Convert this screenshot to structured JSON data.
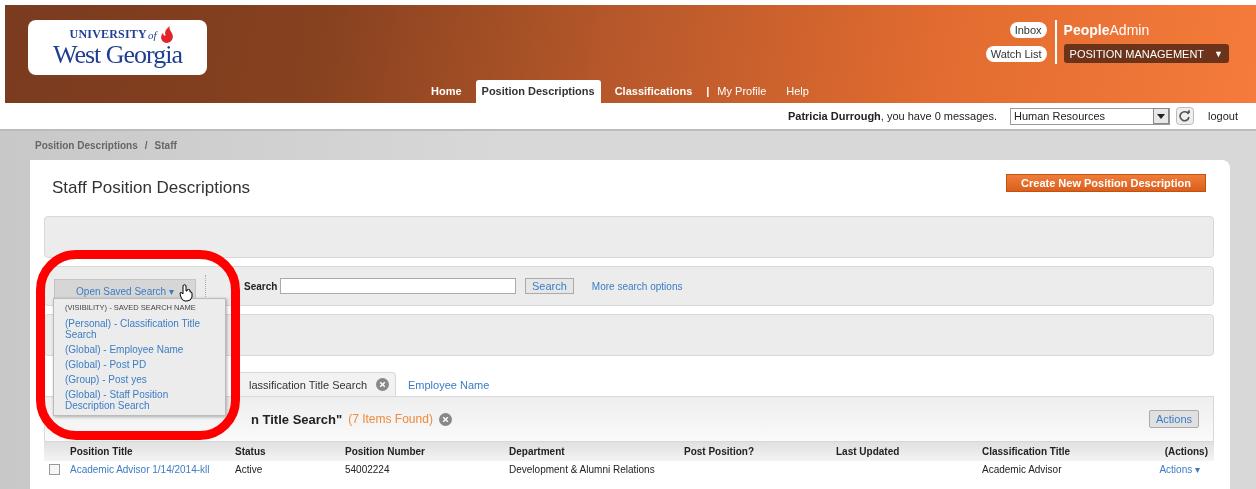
{
  "header": {
    "logo": {
      "line1": "UNIVERSITY",
      "line1_suffix": "of",
      "line2": "West Georgia"
    },
    "nav": [
      {
        "label": "Home",
        "kind": "main",
        "selected": false
      },
      {
        "label": "Position Descriptions",
        "kind": "main",
        "selected": true
      },
      {
        "label": "Classifications",
        "kind": "main",
        "selected": false
      },
      {
        "label": "|",
        "kind": "separator"
      },
      {
        "label": "My Profile",
        "kind": "link",
        "selected": false
      },
      {
        "label": "Help",
        "kind": "link",
        "selected": false
      }
    ],
    "quick_links": [
      "Inbox",
      "Watch List"
    ],
    "product": "**People**Admin",
    "module_menu": {
      "value": "POSITION MANAGEMENT",
      "caret": "▼"
    }
  },
  "user_bar": {
    "greeting": "**Patricia Durrough**, you have 0 messages.",
    "department": "Human Resources",
    "logout": "logout"
  },
  "breadcrumb": {
    "items": [
      "Position Descriptions",
      "Staff"
    ],
    "separator": "/"
  },
  "page": {
    "title": "Staff Position Descriptions",
    "create_button": "Create New Position Description"
  },
  "search": {
    "saved_search_button": "Open Saved Search ▾",
    "label": "Search",
    "button": "Search",
    "more_link": "More search options"
  },
  "saved_search_menu": {
    "header": "(VISIBILITY) - SAVED SEARCH NAME",
    "items": [
      "(Personal) - Classification Title Search",
      "(Global) - Employee Name",
      "(Global) - Post PD",
      "(Group) - Post yes",
      "(Global) - Staff Position Description Search"
    ]
  },
  "result_tabs": [
    {
      "label": "lassification Title Search",
      "selected": true,
      "closable": true
    },
    {
      "label": "Employee Name",
      "selected": false,
      "closable": false
    }
  ],
  "results": {
    "saved_search": "n Title Search\"",
    "count": "(7 Items Found)",
    "actions_button": "Actions"
  },
  "table": {
    "columns": [
      "Position Title",
      "Status",
      "Position Number",
      "Department",
      "Post Position?",
      "Last Updated",
      "Classification Title",
      "(Actions)"
    ],
    "rows": [
      {
        "checked": false,
        "title": "Academic Advisor 1/14/2014-kll",
        "status": "Active",
        "number": "54002224",
        "department": "Development & Alumni Relations",
        "classification": "Academic Advisor",
        "actions": "Actions ▾"
      }
    ]
  }
}
